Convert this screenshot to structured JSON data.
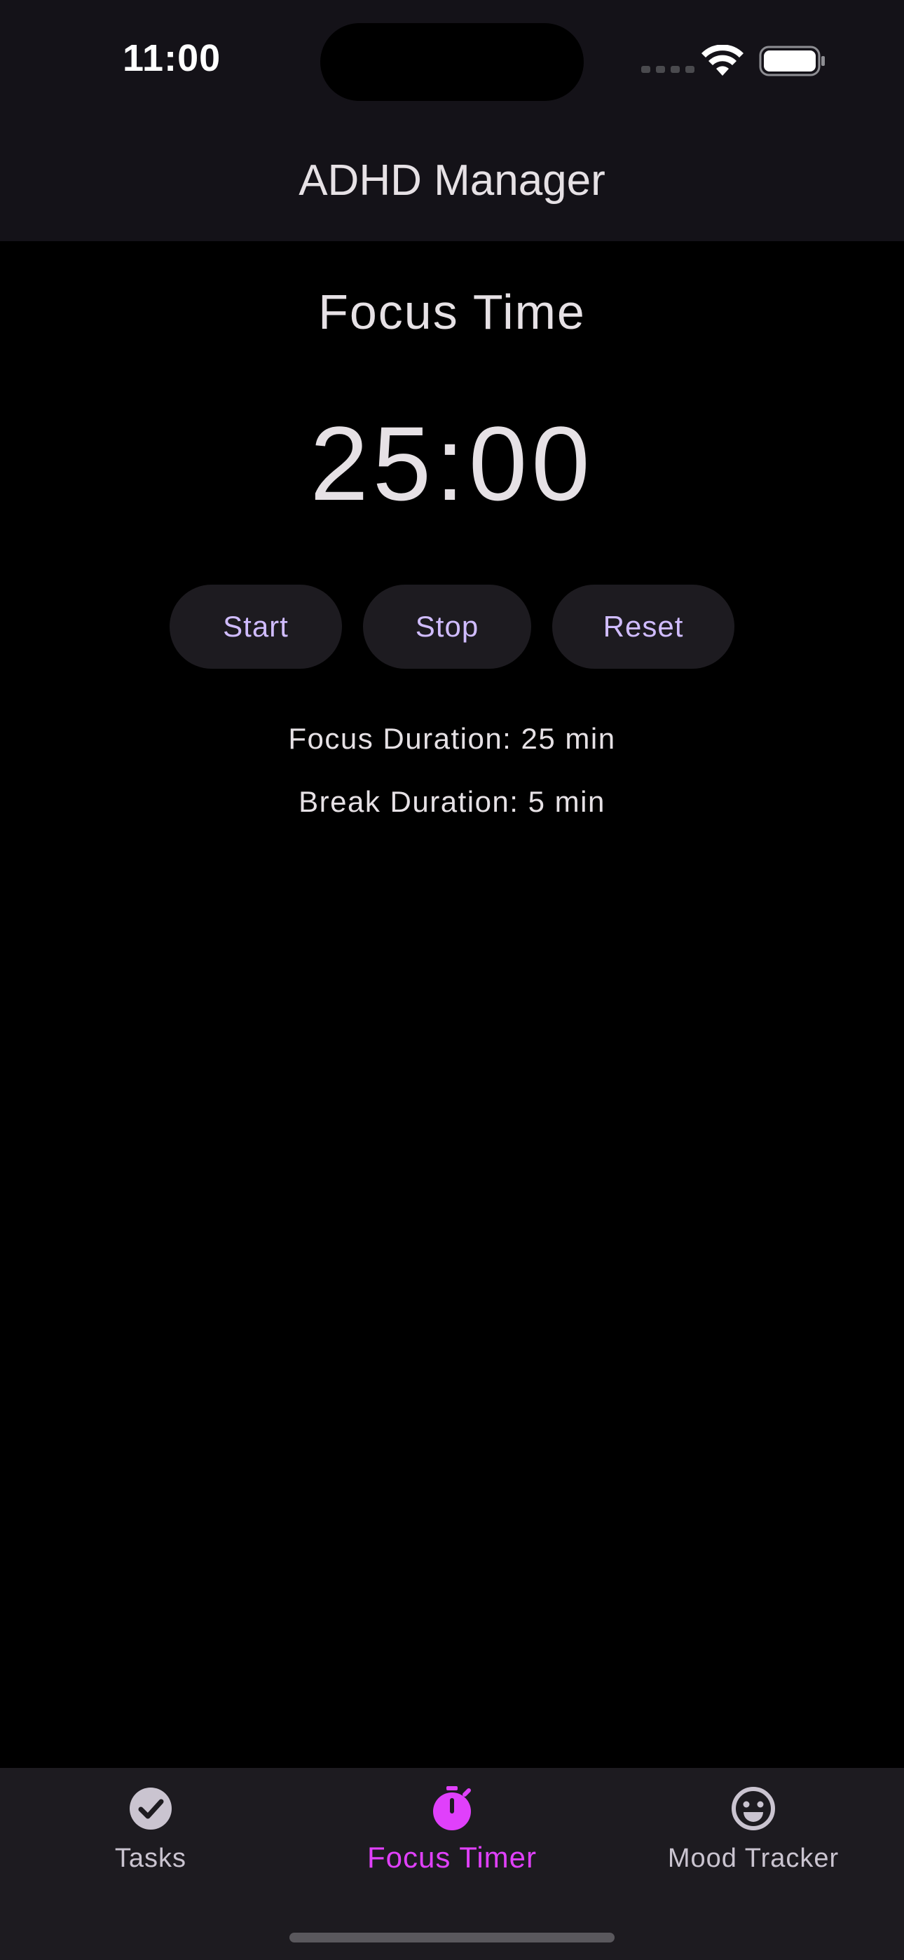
{
  "status_bar": {
    "time": "11:00"
  },
  "app_bar": {
    "title": "ADHD Manager"
  },
  "timer": {
    "section_title": "Focus Time",
    "display": "25:00",
    "buttons": {
      "start": "Start",
      "stop": "Stop",
      "reset": "Reset"
    },
    "focus_duration": "Focus Duration: 25 min",
    "break_duration": "Break Duration: 5 min"
  },
  "bottom_nav": {
    "items": [
      {
        "label": "Tasks",
        "icon": "check-circle-icon",
        "active": false
      },
      {
        "label": "Focus Timer",
        "icon": "stopwatch-icon",
        "active": true
      },
      {
        "label": "Mood Tracker",
        "icon": "smiley-icon",
        "active": false
      }
    ]
  },
  "colors": {
    "background": "#000000",
    "surface": "#141218",
    "button_bg": "#1d1b20",
    "button_text": "#d0bcff",
    "accent_active": "#e040fb",
    "text": "#e6e1e5",
    "nav_inactive": "#cac4d0"
  }
}
